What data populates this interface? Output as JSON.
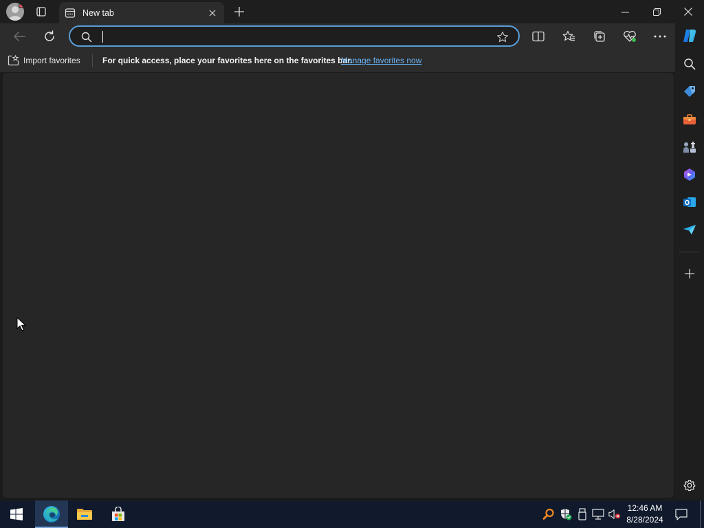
{
  "browser": {
    "tab": {
      "title": "New tab"
    },
    "address_bar": {
      "value": "",
      "placeholder": ""
    },
    "favorites_bar": {
      "import_label": "Import favorites",
      "message": "For quick access, place your favorites here on the favorites bar.",
      "manage_link": "Manage favorites now"
    },
    "toolbar_icons": [
      "back-icon",
      "refresh-icon",
      "split-screen-icon",
      "favorites-icon",
      "collections-icon",
      "browser-essentials-icon",
      "more-icon",
      "copilot-icon"
    ],
    "sidebar_icons": [
      "search-icon",
      "shopping-icon",
      "tools-icon",
      "games-icon",
      "microsoft-365-icon",
      "outlook-icon",
      "drop-icon",
      "add-icon",
      "settings-icon"
    ]
  },
  "taskbar": {
    "pinned": [
      "start-icon",
      "edge-icon",
      "file-explorer-icon",
      "store-icon"
    ],
    "clock": {
      "time": "12:46 AM",
      "date": "8/28/2024"
    }
  },
  "colors": {
    "accent": "#5a9ed8",
    "link": "#6cb4f5",
    "content_bg": "#262626",
    "taskbar_bg": "#101a2c"
  }
}
